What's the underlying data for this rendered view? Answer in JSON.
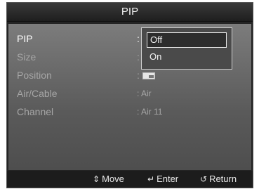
{
  "title": "PIP",
  "menu": {
    "rows": [
      {
        "label": "PIP",
        "value": ":"
      },
      {
        "label": "Size",
        "value": ":"
      },
      {
        "label": "Position",
        "value": ":"
      },
      {
        "label": "Air/Cable",
        "value": ": Air"
      },
      {
        "label": "Channel",
        "value": ": Air 11"
      }
    ]
  },
  "popup": {
    "options": [
      "Off",
      "On"
    ],
    "selected": "Off"
  },
  "footer": {
    "move": {
      "icon": "up-down-arrows-icon",
      "symbol": "⇕",
      "label": "Move"
    },
    "enter": {
      "icon": "enter-icon",
      "symbol": "↵",
      "label": "Enter"
    },
    "return": {
      "icon": "return-icon",
      "symbol": "↺",
      "label": "Return"
    }
  }
}
